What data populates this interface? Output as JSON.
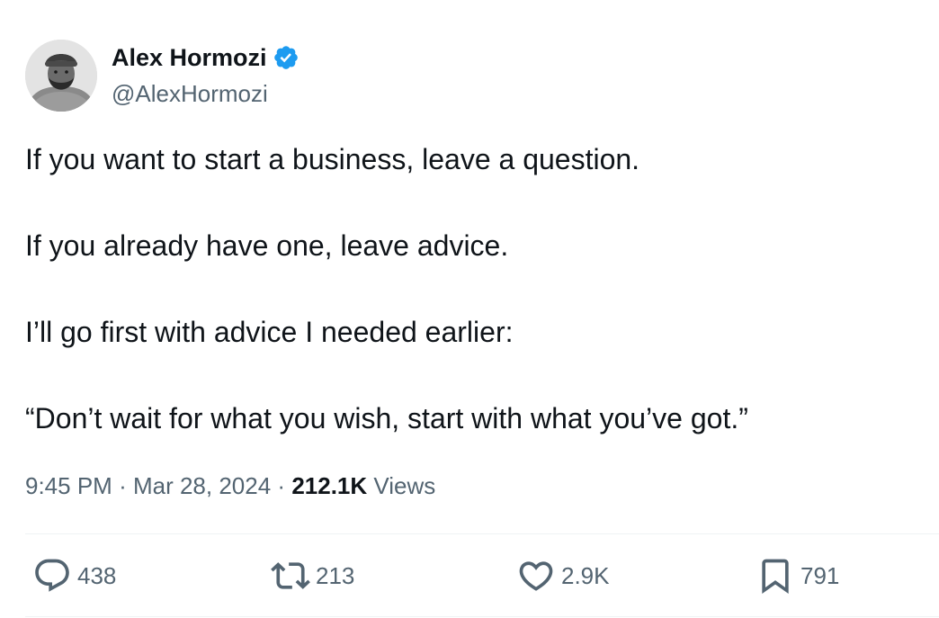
{
  "author": {
    "name": "Alex Hormozi",
    "handle": "@AlexHormozi",
    "verified_color": "#1d9bf0",
    "avatar_icon": "profile-photo"
  },
  "tweet": {
    "lines": [
      "If you want to start a business, leave a question.",
      "If you already have one, leave advice.",
      "I’ll go first with advice I needed earlier:",
      "“Don’t wait for what you wish, start with what you’ve got.”"
    ]
  },
  "meta": {
    "time": "9:45 PM",
    "date": "Mar 28, 2024",
    "separator": "·",
    "views_count": "212.1K",
    "views_label": "Views"
  },
  "actions": {
    "replies": {
      "icon": "reply-icon",
      "count": "438"
    },
    "retweets": {
      "icon": "retweet-icon",
      "count": "213"
    },
    "likes": {
      "icon": "heart-icon",
      "count": "2.9K"
    },
    "bookmarks": {
      "icon": "bookmark-icon",
      "count": "791"
    }
  },
  "colors": {
    "text": "#0f1419",
    "secondary": "#536471",
    "divider": "#eff3f4",
    "accent": "#1d9bf0"
  }
}
